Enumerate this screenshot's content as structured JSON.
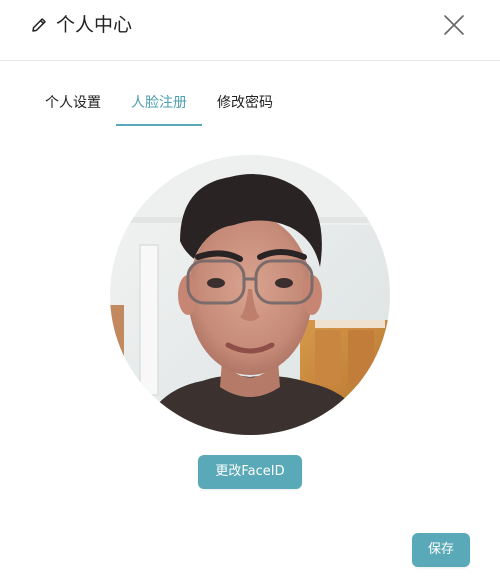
{
  "dialog": {
    "title": "个人中心",
    "edit_icon": "pencil-icon",
    "close_icon": "close-icon"
  },
  "tabs": [
    {
      "label": "个人设置",
      "active": false
    },
    {
      "label": "人脸注册",
      "active": true
    },
    {
      "label": "修改密码",
      "active": false
    }
  ],
  "face": {
    "change_button_label": "更改FaceID"
  },
  "footer": {
    "save_label": "保存"
  },
  "colors": {
    "accent": "#5aa9b8",
    "tab_active_text": "#4e9fb0",
    "divider": "#e6e6e6"
  }
}
